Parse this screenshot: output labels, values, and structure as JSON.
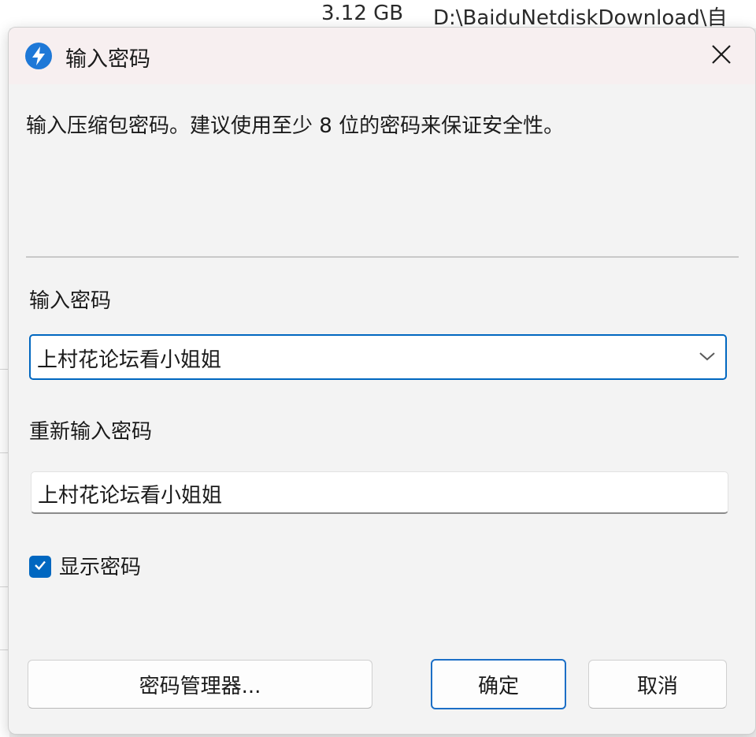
{
  "background": {
    "file_size": "3.12 GB",
    "file_path": "D:\\BaiduNetdiskDownload\\自"
  },
  "dialog": {
    "title": "输入密码",
    "description": "输入压缩包密码。建议使用至少 8 位的密码来保证安全性。",
    "password_label": "输入密码",
    "password_value": "上村花论坛看小姐姐",
    "reenter_label": "重新输入密码",
    "reenter_value": "上村花论坛看小姐姐",
    "show_password_label": "显示密码",
    "show_password_checked": true,
    "buttons": {
      "manager": "密码管理器...",
      "ok": "确定",
      "cancel": "取消"
    }
  },
  "icons": {
    "app": "lightning-bolt-icon",
    "close": "close-icon",
    "dropdown": "chevron-down-icon",
    "check": "checkmark-icon"
  },
  "colors": {
    "accent": "#0067c0",
    "titlebar": "#f7eff0",
    "dialog_bg": "#f3f3f3"
  }
}
